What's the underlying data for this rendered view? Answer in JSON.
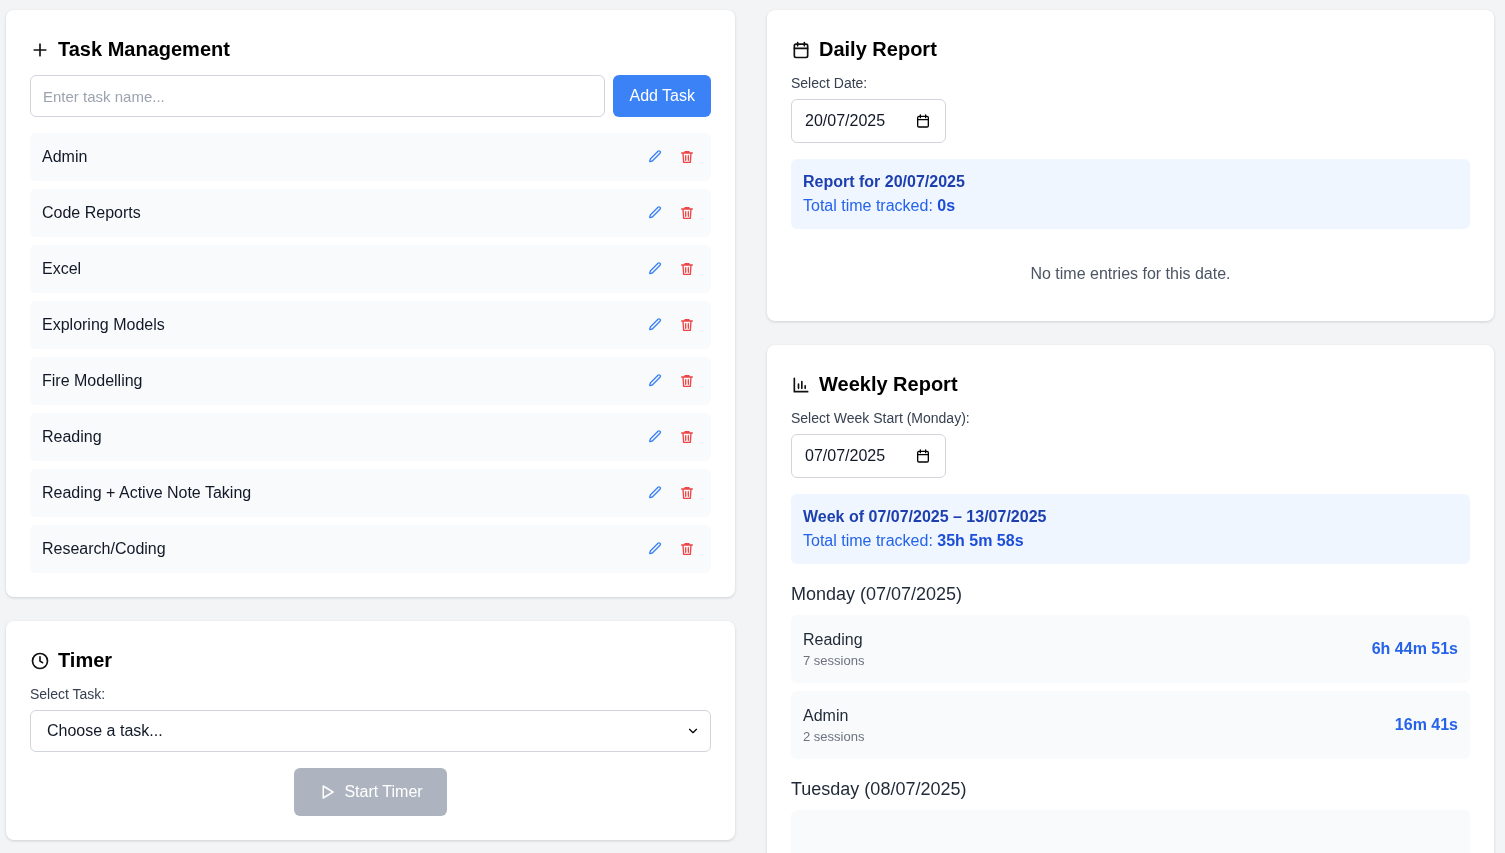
{
  "task_management": {
    "title": "Task Management",
    "input": {
      "placeholder": "Enter task name..."
    },
    "add_button": "Add Task",
    "tasks": [
      {
        "name": "Admin"
      },
      {
        "name": "Code Reports"
      },
      {
        "name": "Excel"
      },
      {
        "name": "Exploring Models"
      },
      {
        "name": "Fire Modelling"
      },
      {
        "name": "Reading"
      },
      {
        "name": "Reading + Active Note Taking"
      },
      {
        "name": "Research/Coding"
      }
    ]
  },
  "timer": {
    "title": "Timer",
    "select_label": "Select Task:",
    "select_value": "Choose a task...",
    "start_button": {
      "label": "Start Timer",
      "disabled": true
    }
  },
  "daily_report": {
    "title": "Daily Report",
    "date_label": "Select Date:",
    "date_value": "20/07/2025",
    "summary_title": "Report for 20/07/2025",
    "total_label": "Total time tracked:",
    "total_value": "0s",
    "empty_message": "No time entries for this date."
  },
  "weekly_report": {
    "title": "Weekly Report",
    "date_label": "Select Week Start (Monday):",
    "date_value": "07/07/2025",
    "summary_title": "Week of 07/07/2025 – 13/07/2025",
    "total_label": "Total time tracked:",
    "total_value": "35h 5m 58s",
    "days": [
      {
        "heading": "Monday (07/07/2025)",
        "entries": [
          {
            "task": "Reading",
            "sessions": "7 sessions",
            "duration": "6h 44m 51s"
          },
          {
            "task": "Admin",
            "sessions": "2 sessions",
            "duration": "16m 41s"
          }
        ]
      },
      {
        "heading": "Tuesday (08/07/2025)",
        "entries_cut_off": true
      }
    ]
  }
}
